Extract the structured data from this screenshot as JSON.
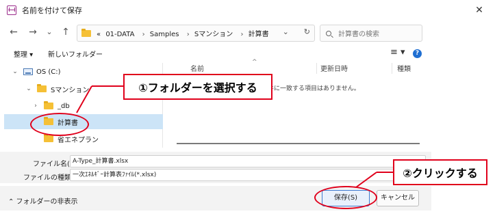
{
  "window": {
    "title": "名前を付けて保存",
    "close": "✕"
  },
  "nav": {
    "back": "←",
    "forward": "→",
    "recent": "⌄",
    "up": "↑",
    "crumbs": [
      "«",
      "01-DATA",
      "›",
      "Samples",
      "›",
      "Sマンション",
      "›",
      "計算書"
    ],
    "dropdown": "⌄",
    "refresh": "↻",
    "search_placeholder": "計算書の検索"
  },
  "toolbar": {
    "organize": "整理 ▾",
    "new_folder": "新しいフォルダー",
    "view": "≡ ▾",
    "help": "?"
  },
  "tree": [
    {
      "label": "OS (C:)",
      "chevron": "⌄",
      "type": "drive"
    },
    {
      "label": "Sマンション",
      "chevron": "⌄",
      "type": "folder"
    },
    {
      "label": "_db",
      "chevron": "›",
      "type": "folder"
    },
    {
      "label": "計算書",
      "chevron": "",
      "type": "folder",
      "selected": true
    },
    {
      "label": "省エネプラン",
      "chevron": "",
      "type": "folder"
    }
  ],
  "list": {
    "columns": [
      "名前",
      "更新日時",
      "種類"
    ],
    "sort_indicator": "^",
    "empty_message": "件に一致する項目はありません。"
  },
  "form": {
    "filename_label": "ファイル名(N):",
    "filename_value": "A-Type_計算書.xlsx",
    "filetype_label": "ファイルの種類(T):",
    "filetype_value": "一次ｴﾈﾙｷﾞｰ計算表ﾌｧｲﾙ(*.xlsx)"
  },
  "footer": {
    "hide_folders": "⌃ フォルダーの非表示",
    "save": "保存(S)",
    "cancel": "キャンセル"
  },
  "annotations": {
    "step1": "①フォルダーを選択する",
    "step2": "②クリックする",
    "color": "#e0001b"
  }
}
